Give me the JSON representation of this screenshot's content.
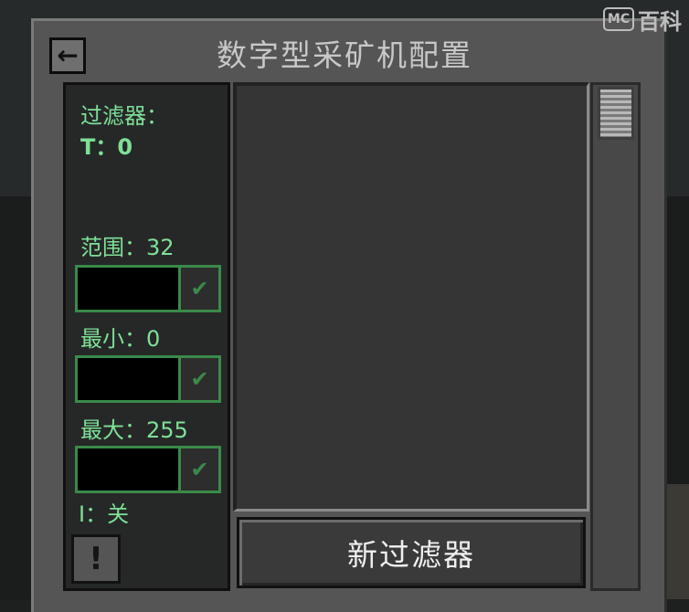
{
  "watermark": {
    "badge": "MC",
    "text": "百科"
  },
  "window": {
    "title": "数字型采矿机配置",
    "back_icon": "arrow-left-icon"
  },
  "sidebar": {
    "filter_label": "过滤器：",
    "filter_value": "T：0",
    "range_label": "范围：32",
    "min_label": "最小：0",
    "max_label": "最大：255",
    "inverse_label": "I：关",
    "confirm_icon": "checkmark-icon",
    "warning_label": "!"
  },
  "main": {
    "new_filter_button": "新过滤器"
  },
  "colors": {
    "label_green": "#7ee096",
    "field_border": "#3a8a4a",
    "panel_gray": "#555555"
  }
}
